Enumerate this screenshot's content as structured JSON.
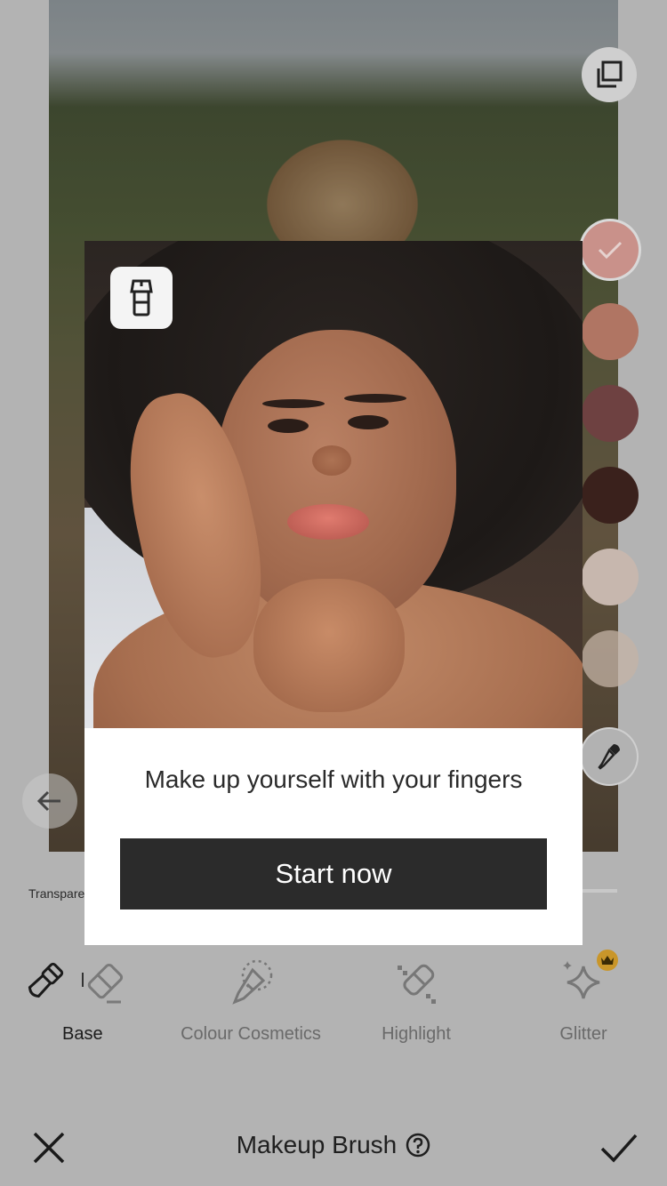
{
  "modal": {
    "message": "Make up yourself with your fingers",
    "start_label": "Start now"
  },
  "panel": {
    "transparency_label": "Transparency"
  },
  "tools": [
    {
      "label": "Base",
      "icon": "brush-icon",
      "active": true
    },
    {
      "label": "Colour Cosmetics",
      "icon": "sparkle-brush-icon",
      "active": false
    },
    {
      "label": "Highlight",
      "icon": "highlight-brush-icon",
      "active": false
    },
    {
      "label": "Glitter",
      "icon": "glitter-star-icon",
      "active": false,
      "premium": true
    }
  ],
  "swatches": [
    "#c9918a",
    "#b07563",
    "#6e4141",
    "#3a211c",
    "#c7b7ae",
    "#c4b3a6"
  ],
  "selected_swatch": 0,
  "bottom_bar": {
    "title": "Makeup Brush"
  },
  "colors": {
    "accent_dark": "#2b2b2b",
    "premium_gold": "#c9962a"
  }
}
